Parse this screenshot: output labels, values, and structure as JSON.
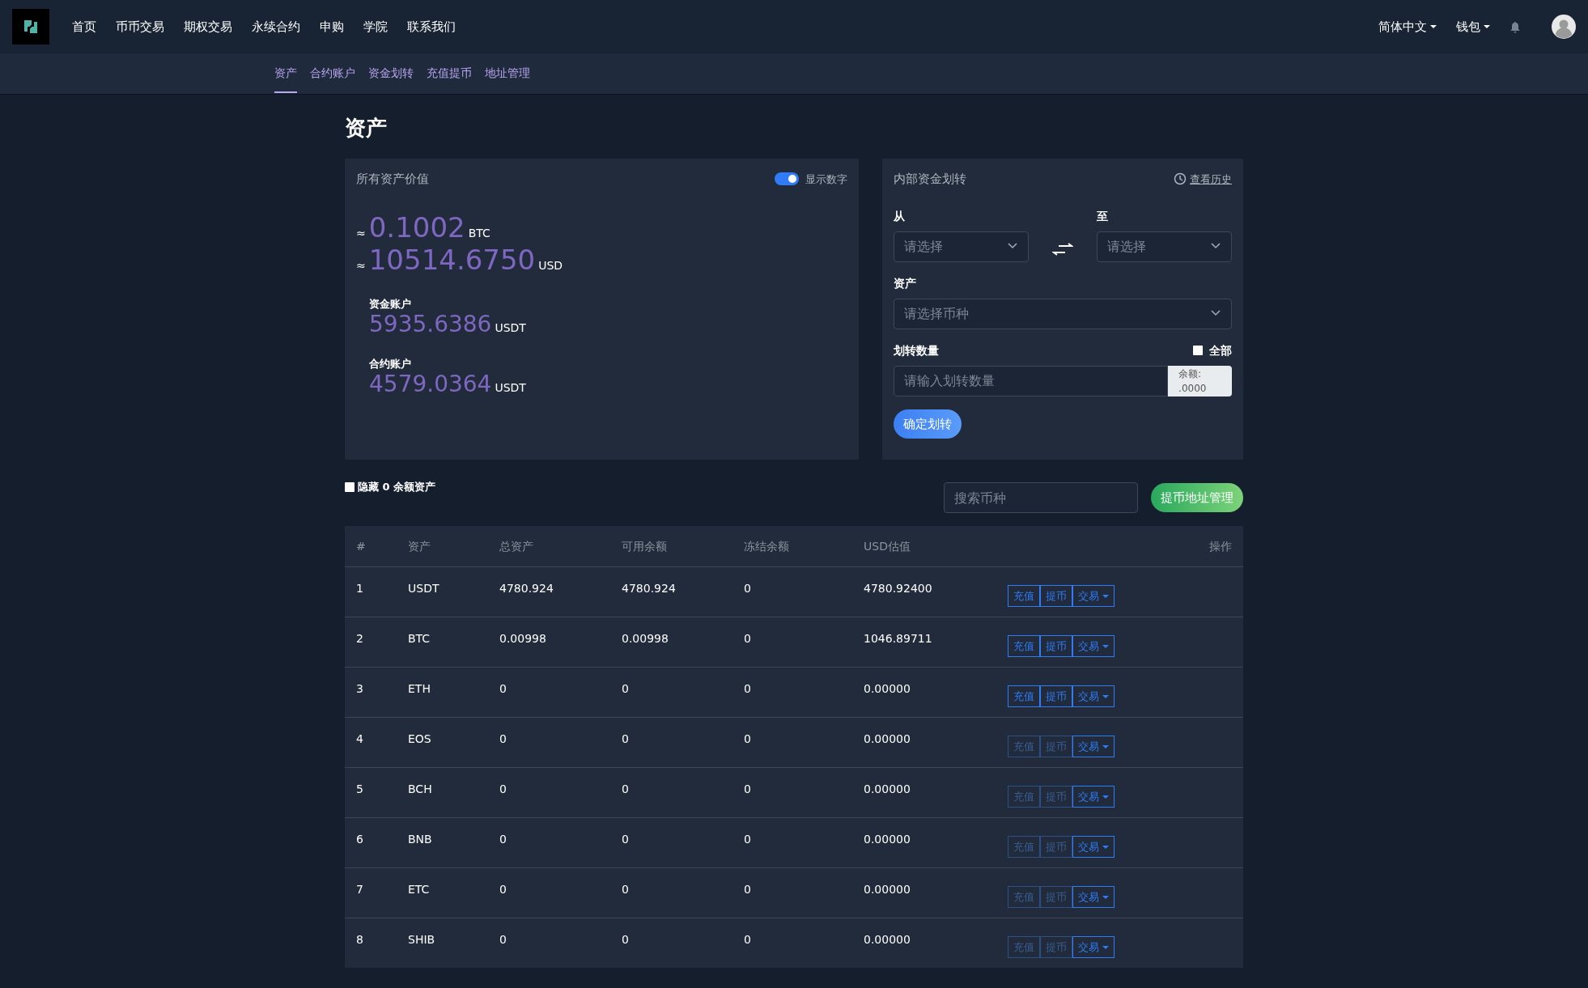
{
  "navbar": {
    "menu": [
      {
        "label": "首页"
      },
      {
        "label": "币币交易"
      },
      {
        "label": "期权交易"
      },
      {
        "label": "永续合约"
      },
      {
        "label": "申购"
      },
      {
        "label": "学院"
      },
      {
        "label": "联系我们"
      }
    ],
    "language": "简体中文",
    "wallet": "钱包"
  },
  "subnav": [
    {
      "label": "资产",
      "selected": true
    },
    {
      "label": "合约账户",
      "selected": false
    },
    {
      "label": "资金划转",
      "selected": false
    },
    {
      "label": "充值提币",
      "selected": false
    },
    {
      "label": "地址管理",
      "selected": false
    }
  ],
  "page_title": "资产",
  "assets_card": {
    "title": "所有资产价值",
    "toggle": {
      "label": "显示数字",
      "on": true
    },
    "totals": [
      {
        "prefix": "≈",
        "value": "0.1002",
        "unit": "BTC"
      },
      {
        "prefix": "≈",
        "value": "10514.6750",
        "unit": "USD"
      }
    ],
    "accounts": [
      {
        "label": "资金账户",
        "value": "5935.6386",
        "unit": "USDT"
      },
      {
        "label": "合约账户",
        "value": "4579.0364",
        "unit": "USDT"
      }
    ]
  },
  "transfer_card": {
    "title": "内部资金划转",
    "history": "查看历史",
    "from_label": "从",
    "from_placeholder": "请选择",
    "to_label": "至",
    "to_placeholder": "请选择",
    "asset_label": "资产",
    "asset_placeholder": "请选择币种",
    "amount_label": "划转数量",
    "all": {
      "label": "全部",
      "checked": false
    },
    "amount_placeholder": "请输入划转数量",
    "balance": "余额: .0000",
    "submit": "确定划转"
  },
  "filters": {
    "hide_zero": {
      "label": "隐藏 0 余额资产",
      "checked": false
    },
    "search_placeholder": "搜索币种",
    "address_button": "提币地址管理"
  },
  "table": {
    "columns": [
      "#",
      "资产",
      "总资产",
      "可用余额",
      "冻结余额",
      "USD估值",
      "操作"
    ],
    "rows": [
      {
        "cells": [
          "1",
          "USDT",
          "4780.924",
          "4780.924",
          "0",
          "4780.92400"
        ],
        "actions": [
          {
            "label": "充值",
            "disabled": false
          },
          {
            "label": "提币",
            "disabled": false
          },
          {
            "label": "交易",
            "disabled": false
          }
        ]
      },
      {
        "cells": [
          "2",
          "BTC",
          "0.00998",
          "0.00998",
          "0",
          "1046.89711"
        ],
        "actions": [
          {
            "label": "充值",
            "disabled": false
          },
          {
            "label": "提币",
            "disabled": false
          },
          {
            "label": "交易",
            "disabled": false
          }
        ]
      },
      {
        "cells": [
          "3",
          "ETH",
          "0",
          "0",
          "0",
          "0.00000"
        ],
        "actions": [
          {
            "label": "充值",
            "disabled": false
          },
          {
            "label": "提币",
            "disabled": false
          },
          {
            "label": "交易",
            "disabled": false
          }
        ]
      },
      {
        "cells": [
          "4",
          "EOS",
          "0",
          "0",
          "0",
          "0.00000"
        ],
        "actions": [
          {
            "label": "充值",
            "disabled": true
          },
          {
            "label": "提币",
            "disabled": true
          },
          {
            "label": "交易",
            "disabled": false
          }
        ]
      },
      {
        "cells": [
          "5",
          "BCH",
          "0",
          "0",
          "0",
          "0.00000"
        ],
        "actions": [
          {
            "label": "充值",
            "disabled": true
          },
          {
            "label": "提币",
            "disabled": true
          },
          {
            "label": "交易",
            "disabled": false
          }
        ]
      },
      {
        "cells": [
          "6",
          "BNB",
          "0",
          "0",
          "0",
          "0.00000"
        ],
        "actions": [
          {
            "label": "充值",
            "disabled": true
          },
          {
            "label": "提币",
            "disabled": true
          },
          {
            "label": "交易",
            "disabled": false
          }
        ]
      },
      {
        "cells": [
          "7",
          "ETC",
          "0",
          "0",
          "0",
          "0.00000"
        ],
        "actions": [
          {
            "label": "充值",
            "disabled": true
          },
          {
            "label": "提币",
            "disabled": true
          },
          {
            "label": "交易",
            "disabled": false
          }
        ]
      },
      {
        "cells": [
          "8",
          "SHIB",
          "0",
          "0",
          "0",
          "0.00000"
        ],
        "actions": [
          {
            "label": "充值",
            "disabled": true
          },
          {
            "label": "提币",
            "disabled": true
          },
          {
            "label": "交易",
            "disabled": false
          }
        ]
      }
    ]
  }
}
